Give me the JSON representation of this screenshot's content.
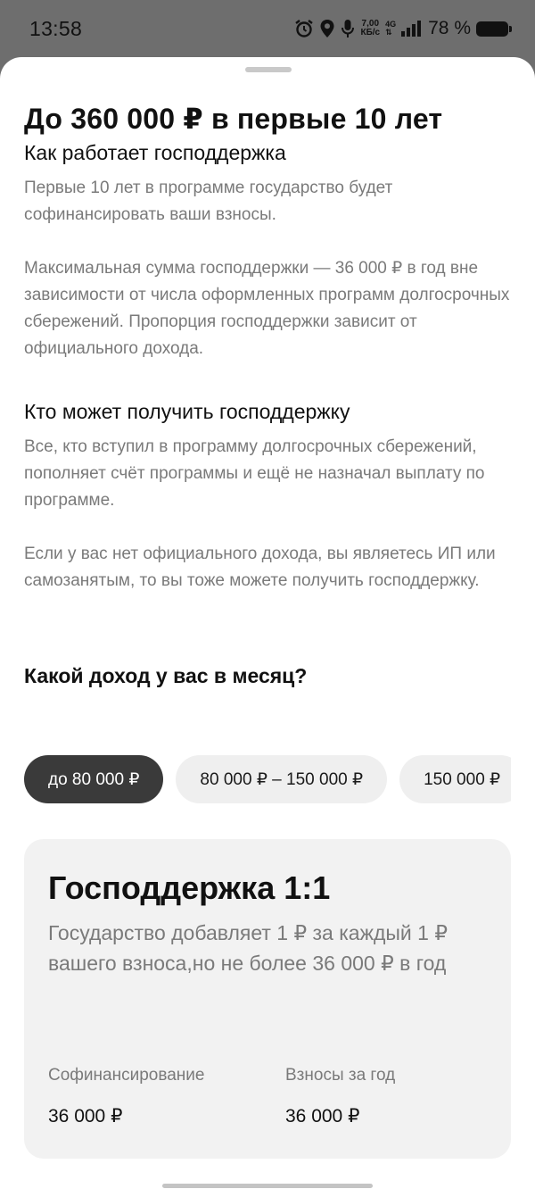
{
  "status_bar": {
    "time": "13:58",
    "net_speed_value": "7,00",
    "net_speed_unit": "КБ/с",
    "network_type": "4G",
    "battery_percent": "78 %",
    "icons": [
      "alarm-icon",
      "location-icon",
      "mic-icon",
      "signal-icon",
      "battery-icon"
    ]
  },
  "sheet": {
    "title": "До 360 000 ₽ в первые 10 лет",
    "how_heading": "Как работает господдержка",
    "how_p1": "Первые 10 лет в программе государство будет софинансировать ваши взносы.",
    "how_p2": "Максимальная сумма господдержки — 36 000 ₽ в год вне зависимости от числа оформленных программ долгосрочных сбережений. Пропорция господдержки зависит от официального дохода.",
    "who_heading": "Кто может получить господдержку",
    "who_p1": "Все, кто вступил в программу долгосрочных сбережений, пополняет счёт программы и ещё не назначал выплату по программе.",
    "who_p2": "Если у вас нет официального дохода, вы являетесь ИП или самозанятым, то вы тоже можете получить господдержку.",
    "income_question": "Какой доход у вас в месяц?",
    "income_options": [
      {
        "label": "до 80 000 ₽",
        "selected": true
      },
      {
        "label": "80 000 ₽ – 150 000 ₽",
        "selected": false
      },
      {
        "label": "150 000 ₽",
        "selected": false
      }
    ],
    "card": {
      "title": "Господдержка 1:1",
      "description": "Государство добавляет 1 ₽ за каждый 1 ₽ вашего взноса,но не более 36 000 ₽ в год",
      "cofinancing_label": "Софинансирование",
      "cofinancing_value": "36 000 ₽",
      "contributions_label": "Взносы за год",
      "contributions_value": "36 000 ₽"
    }
  },
  "colors": {
    "selected_chip_bg": "#3a3a3a",
    "chip_bg": "#efefef",
    "card_bg": "#f2f2f2",
    "muted_text": "#7a7a7a"
  }
}
